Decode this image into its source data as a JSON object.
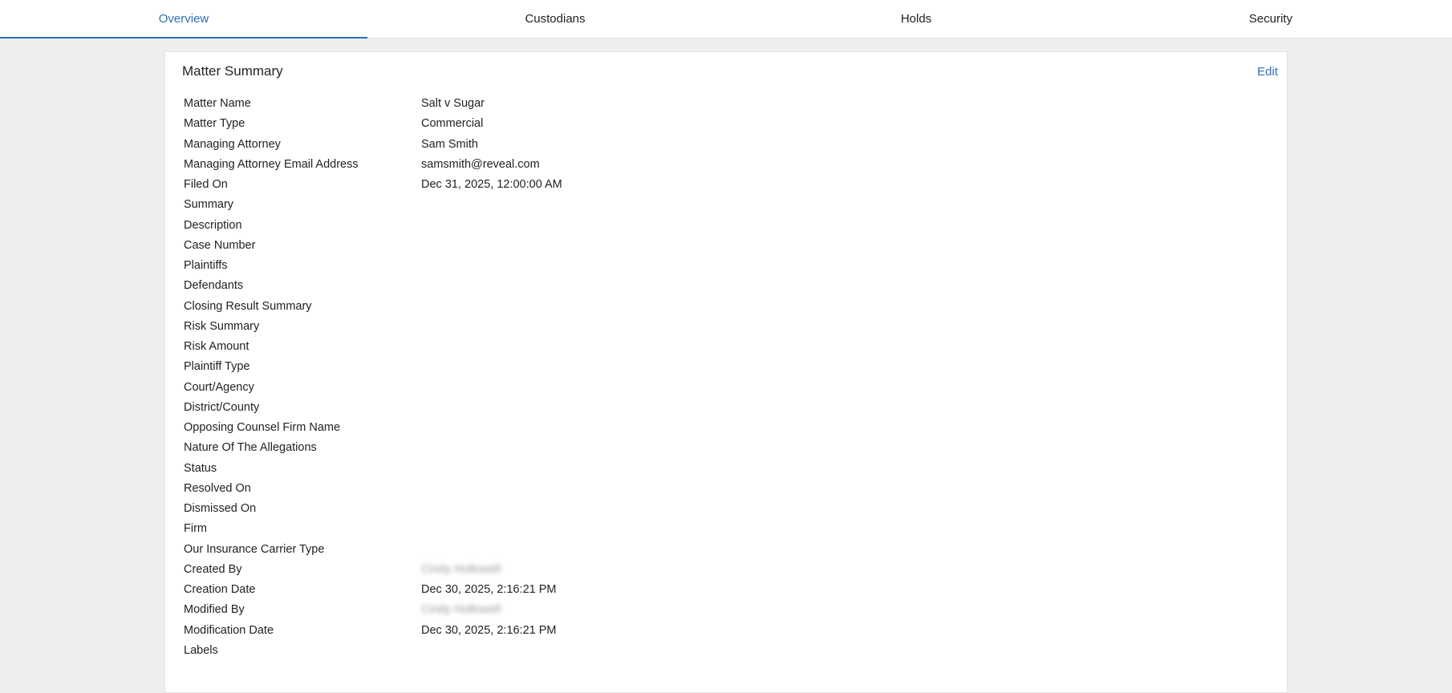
{
  "tabs": [
    {
      "label": "Overview",
      "active": true
    },
    {
      "label": "Custodians",
      "active": false
    },
    {
      "label": "Holds",
      "active": false
    },
    {
      "label": "Security",
      "active": false
    }
  ],
  "card": {
    "title": "Matter Summary",
    "edit_label": "Edit"
  },
  "fields": [
    {
      "label": "Matter Name",
      "value": "Salt v Sugar"
    },
    {
      "label": "Matter Type",
      "value": "Commercial"
    },
    {
      "label": "Managing Attorney",
      "value": "Sam Smith"
    },
    {
      "label": "Managing Attorney Email Address",
      "value": "samsmith@reveal.com"
    },
    {
      "label": "Filed On",
      "value": "Dec 31, 2025, 12:00:00 AM"
    },
    {
      "label": "Summary",
      "value": ""
    },
    {
      "label": "Description",
      "value": ""
    },
    {
      "label": "Case Number",
      "value": ""
    },
    {
      "label": "Plaintiffs",
      "value": ""
    },
    {
      "label": "Defendants",
      "value": ""
    },
    {
      "label": "Closing Result Summary",
      "value": ""
    },
    {
      "label": "Risk Summary",
      "value": ""
    },
    {
      "label": "Risk Amount",
      "value": ""
    },
    {
      "label": "Plaintiff Type",
      "value": ""
    },
    {
      "label": "Court/Agency",
      "value": ""
    },
    {
      "label": "District/County",
      "value": ""
    },
    {
      "label": "Opposing Counsel Firm Name",
      "value": ""
    },
    {
      "label": "Nature Of The Allegations",
      "value": ""
    },
    {
      "label": "Status",
      "value": ""
    },
    {
      "label": "Resolved On",
      "value": ""
    },
    {
      "label": "Dismissed On",
      "value": ""
    },
    {
      "label": "Firm",
      "value": ""
    },
    {
      "label": "Our Insurance Carrier Type",
      "value": ""
    },
    {
      "label": "Created By",
      "value": "Cindy Hollowell",
      "redacted": true
    },
    {
      "label": "Creation Date",
      "value": "Dec 30, 2025, 2:16:21 PM"
    },
    {
      "label": "Modified By",
      "value": "Cindy Hollowell",
      "redacted": true
    },
    {
      "label": "Modification Date",
      "value": "Dec 30, 2025, 2:16:21 PM"
    },
    {
      "label": "Labels",
      "value": ""
    }
  ],
  "colors": {
    "accent": "#2f6fb6",
    "page_background": "#eeeeee",
    "card_background": "#ffffff"
  }
}
